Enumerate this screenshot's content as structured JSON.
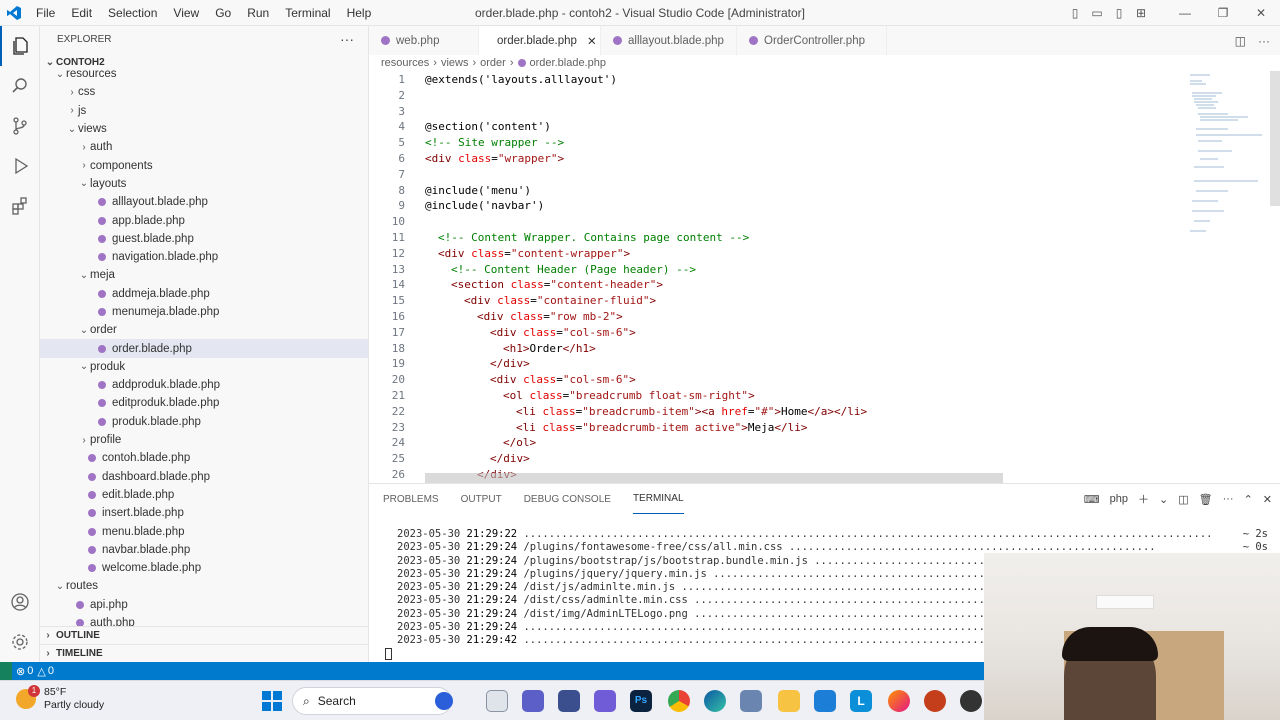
{
  "window": {
    "title": "order.blade.php - contoh2 - Visual Studio Code [Administrator]"
  },
  "menu": [
    "File",
    "Edit",
    "Selection",
    "View",
    "Go",
    "Run",
    "Terminal",
    "Help"
  ],
  "explorer": {
    "header": "EXPLORER",
    "project": "CONTOH2",
    "items": [
      {
        "label": "resources",
        "depth": 1,
        "type": "folder",
        "open": true
      },
      {
        "label": "css",
        "depth": 2,
        "type": "folder",
        "open": false
      },
      {
        "label": "js",
        "depth": 2,
        "type": "folder",
        "open": false
      },
      {
        "label": "views",
        "depth": 2,
        "type": "folder",
        "open": true
      },
      {
        "label": "auth",
        "depth": 3,
        "type": "folder",
        "open": false
      },
      {
        "label": "components",
        "depth": 3,
        "type": "folder",
        "open": false
      },
      {
        "label": "layouts",
        "depth": 3,
        "type": "folder",
        "open": true
      },
      {
        "label": "alllayout.blade.php",
        "depth": 4,
        "type": "file"
      },
      {
        "label": "app.blade.php",
        "depth": 4,
        "type": "file"
      },
      {
        "label": "guest.blade.php",
        "depth": 4,
        "type": "file"
      },
      {
        "label": "navigation.blade.php",
        "depth": 4,
        "type": "file"
      },
      {
        "label": "meja",
        "depth": 3,
        "type": "folder",
        "open": true
      },
      {
        "label": "addmeja.blade.php",
        "depth": 4,
        "type": "file"
      },
      {
        "label": "menumeja.blade.php",
        "depth": 4,
        "type": "file"
      },
      {
        "label": "order",
        "depth": 3,
        "type": "folder",
        "open": true
      },
      {
        "label": "order.blade.php",
        "depth": 4,
        "type": "file",
        "selected": true
      },
      {
        "label": "produk",
        "depth": 3,
        "type": "folder",
        "open": true
      },
      {
        "label": "addproduk.blade.php",
        "depth": 4,
        "type": "file"
      },
      {
        "label": "editproduk.blade.php",
        "depth": 4,
        "type": "file"
      },
      {
        "label": "produk.blade.php",
        "depth": 4,
        "type": "file"
      },
      {
        "label": "profile",
        "depth": 3,
        "type": "folder",
        "open": false
      },
      {
        "label": "contoh.blade.php",
        "depth": 3,
        "type": "file"
      },
      {
        "label": "dashboard.blade.php",
        "depth": 3,
        "type": "file"
      },
      {
        "label": "edit.blade.php",
        "depth": 3,
        "type": "file"
      },
      {
        "label": "insert.blade.php",
        "depth": 3,
        "type": "file"
      },
      {
        "label": "menu.blade.php",
        "depth": 3,
        "type": "file"
      },
      {
        "label": "navbar.blade.php",
        "depth": 3,
        "type": "file"
      },
      {
        "label": "welcome.blade.php",
        "depth": 3,
        "type": "file"
      },
      {
        "label": "routes",
        "depth": 1,
        "type": "folder",
        "open": true
      },
      {
        "label": "api.php",
        "depth": 2,
        "type": "file"
      },
      {
        "label": "auth.php",
        "depth": 2,
        "type": "file"
      }
    ],
    "outline": "OUTLINE",
    "timeline": "TIMELINE"
  },
  "tabs": [
    {
      "label": "web.php",
      "active": false
    },
    {
      "label": "order.blade.php",
      "active": true
    },
    {
      "label": "alllayout.blade.php",
      "active": false
    },
    {
      "label": "OrderController.php",
      "active": false
    }
  ],
  "breadcrumb": [
    "resources",
    "views",
    "order",
    "order.blade.php"
  ],
  "code": [
    {
      "n": "1",
      "i": 0,
      "t": [
        [
          "dir",
          "@extends('layouts.alllayout')"
        ]
      ]
    },
    {
      "n": "2",
      "i": 0,
      "t": []
    },
    {
      "n": "3",
      "i": 0,
      "t": []
    },
    {
      "n": "4",
      "i": 0,
      "t": [
        [
          "dir",
          "@section('content')"
        ]
      ]
    },
    {
      "n": "5",
      "i": 0,
      "t": [
        [
          "cmt",
          "<!-- Site wrapper -->"
        ]
      ]
    },
    {
      "n": "6",
      "i": 0,
      "t": [
        [
          "tag",
          "<div "
        ],
        [
          "attr",
          "class"
        ],
        [
          "txt",
          "="
        ],
        [
          "str",
          "\"wrapper\""
        ],
        [
          "tag",
          ">"
        ]
      ]
    },
    {
      "n": "7",
      "i": 0,
      "t": []
    },
    {
      "n": "8",
      "i": 0,
      "t": [
        [
          "dir",
          "@include('menu')"
        ]
      ]
    },
    {
      "n": "9",
      "i": 0,
      "t": [
        [
          "dir",
          "@include('navbar')"
        ]
      ]
    },
    {
      "n": "10",
      "i": 0,
      "t": []
    },
    {
      "n": "11",
      "i": 1,
      "t": [
        [
          "cmt",
          "<!-- Content Wrapper. Contains page content -->"
        ]
      ]
    },
    {
      "n": "12",
      "i": 1,
      "t": [
        [
          "tag",
          "<div "
        ],
        [
          "attr",
          "class"
        ],
        [
          "txt",
          "="
        ],
        [
          "str",
          "\"content-wrapper\""
        ],
        [
          "tag",
          ">"
        ]
      ]
    },
    {
      "n": "13",
      "i": 2,
      "t": [
        [
          "cmt",
          "<!-- Content Header (Page header) -->"
        ]
      ]
    },
    {
      "n": "14",
      "i": 2,
      "t": [
        [
          "tag",
          "<section "
        ],
        [
          "attr",
          "class"
        ],
        [
          "txt",
          "="
        ],
        [
          "str",
          "\"content-header\""
        ],
        [
          "tag",
          ">"
        ]
      ]
    },
    {
      "n": "15",
      "i": 3,
      "t": [
        [
          "tag",
          "<div "
        ],
        [
          "attr",
          "class"
        ],
        [
          "txt",
          "="
        ],
        [
          "str",
          "\"container-fluid\""
        ],
        [
          "tag",
          ">"
        ]
      ]
    },
    {
      "n": "16",
      "i": 4,
      "t": [
        [
          "tag",
          "<div "
        ],
        [
          "attr",
          "class"
        ],
        [
          "txt",
          "="
        ],
        [
          "str",
          "\"row mb-2\""
        ],
        [
          "tag",
          ">"
        ]
      ]
    },
    {
      "n": "17",
      "i": 5,
      "t": [
        [
          "tag",
          "<div "
        ],
        [
          "attr",
          "class"
        ],
        [
          "txt",
          "="
        ],
        [
          "str",
          "\"col-sm-6\""
        ],
        [
          "tag",
          ">"
        ]
      ]
    },
    {
      "n": "18",
      "i": 6,
      "t": [
        [
          "tag",
          "<h1>"
        ],
        [
          "txt",
          "Order"
        ],
        [
          "tag",
          "</h1>"
        ]
      ]
    },
    {
      "n": "19",
      "i": 5,
      "t": [
        [
          "tag",
          "</div>"
        ]
      ]
    },
    {
      "n": "20",
      "i": 5,
      "t": [
        [
          "tag",
          "<div "
        ],
        [
          "attr",
          "class"
        ],
        [
          "txt",
          "="
        ],
        [
          "str",
          "\"col-sm-6\""
        ],
        [
          "tag",
          ">"
        ]
      ]
    },
    {
      "n": "21",
      "i": 6,
      "t": [
        [
          "tag",
          "<ol "
        ],
        [
          "attr",
          "class"
        ],
        [
          "txt",
          "="
        ],
        [
          "str",
          "\"breadcrumb float-sm-right\""
        ],
        [
          "tag",
          ">"
        ]
      ]
    },
    {
      "n": "22",
      "i": 7,
      "t": [
        [
          "tag",
          "<li "
        ],
        [
          "attr",
          "class"
        ],
        [
          "txt",
          "="
        ],
        [
          "str",
          "\"breadcrumb-item\""
        ],
        [
          "tag",
          "><a "
        ],
        [
          "attr",
          "href"
        ],
        [
          "txt",
          "="
        ],
        [
          "str",
          "\"#\""
        ],
        [
          "tag",
          ">"
        ],
        [
          "txt",
          "Home"
        ],
        [
          "tag",
          "</a></li>"
        ]
      ]
    },
    {
      "n": "23",
      "i": 7,
      "t": [
        [
          "tag",
          "<li "
        ],
        [
          "attr",
          "class"
        ],
        [
          "txt",
          "="
        ],
        [
          "str",
          "\"breadcrumb-item active\""
        ],
        [
          "tag",
          ">"
        ],
        [
          "txt",
          "Meja"
        ],
        [
          "tag",
          "</li>"
        ]
      ]
    },
    {
      "n": "24",
      "i": 6,
      "t": [
        [
          "tag",
          "</ol>"
        ]
      ]
    },
    {
      "n": "25",
      "i": 5,
      "t": [
        [
          "tag",
          "</div>"
        ]
      ]
    },
    {
      "n": "26",
      "i": 4,
      "t": [
        [
          "tag",
          "</div>"
        ]
      ]
    }
  ],
  "panel": {
    "tabs": [
      "PROBLEMS",
      "OUTPUT",
      "DEBUG CONSOLE",
      "TERMINAL"
    ],
    "active": "TERMINAL",
    "shell": "php",
    "terminal": [
      {
        "date": "2023-05-30",
        "time": "21:29:22",
        "text": " .............................................................................................................",
        "dur": "~ 2s"
      },
      {
        "date": "2023-05-30",
        "time": "21:29:24",
        "text": " /plugins/fontawesome-free/css/all.min.css ..........................................................",
        "dur": "~ 0s"
      },
      {
        "date": "2023-05-30",
        "time": "21:29:24",
        "text": " /plugins/bootstrap/js/bootstrap.bundle.min.js ......................................................",
        "dur": ""
      },
      {
        "date": "2023-05-30",
        "time": "21:29:24",
        "text": " /plugins/jquery/jquery.min.js .....................................................................",
        "dur": ""
      },
      {
        "date": "2023-05-30",
        "time": "21:29:24",
        "text": " /dist/js/adminlte.min.js ..........................................................................",
        "dur": ""
      },
      {
        "date": "2023-05-30",
        "time": "21:29:24",
        "text": " /dist/css/adminlte.min.css ........................................................................",
        "dur": ""
      },
      {
        "date": "2023-05-30",
        "time": "21:29:24",
        "text": " /dist/img/AdminLTELogo.png ........................................................................",
        "dur": ""
      },
      {
        "date": "2023-05-30",
        "time": "21:29:24",
        "text": " ..................................................................................................",
        "dur": ""
      },
      {
        "date": "2023-05-30",
        "time": "21:29:42",
        "text": " ..................................................................................................",
        "dur": ""
      }
    ]
  },
  "status": {
    "errors": "0",
    "warnings": "0"
  },
  "taskbar": {
    "temp": "85°F",
    "weather": "Partly cloudy",
    "badge": "1",
    "search": "Search"
  }
}
